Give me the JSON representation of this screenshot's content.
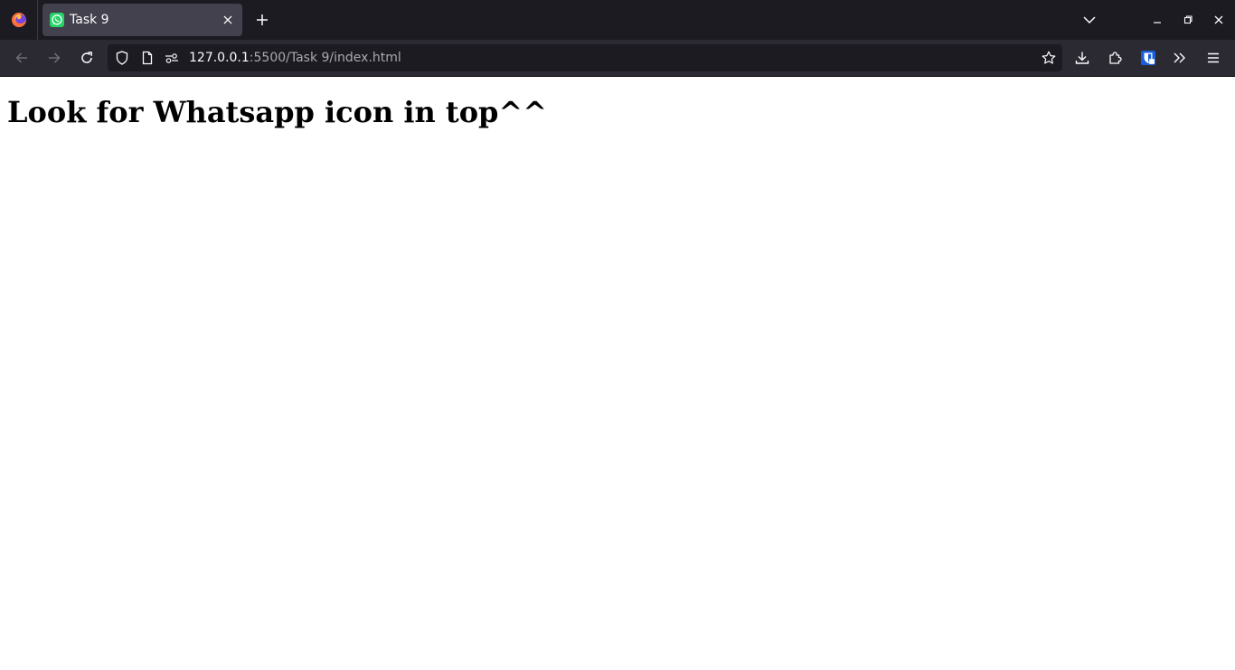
{
  "browser": {
    "tab": {
      "title": "Task 9",
      "favicon": "whatsapp-icon"
    },
    "urlbar": {
      "host": "127.0.0.1",
      "path": ":5500/Task 9/index.html"
    },
    "icons": {
      "firefox": "firefox-logo-icon",
      "new_tab": "plus-icon",
      "tab_list": "chevron-down-icon",
      "back": "arrow-left-icon",
      "forward": "arrow-right-icon",
      "reload": "reload-icon",
      "tracking": "shield-icon",
      "page": "page-icon",
      "permissions": "permissions-icon",
      "bookmark": "star-icon",
      "downloads": "download-icon",
      "extensions": "puzzle-icon",
      "bitwarden": "bitwarden-icon",
      "overflow": "double-chevron-icon",
      "menu": "hamburger-icon"
    },
    "colors": {
      "tabstrip": "#1c1b22",
      "selected_tab": "#42414d",
      "navbar": "#2b2a33",
      "urlbar": "#1c1b22",
      "whatsapp_green": "#25d366",
      "bitwarden_blue": "#175ddc"
    }
  },
  "page": {
    "heading": "Look for Whatsapp icon in top^^"
  }
}
